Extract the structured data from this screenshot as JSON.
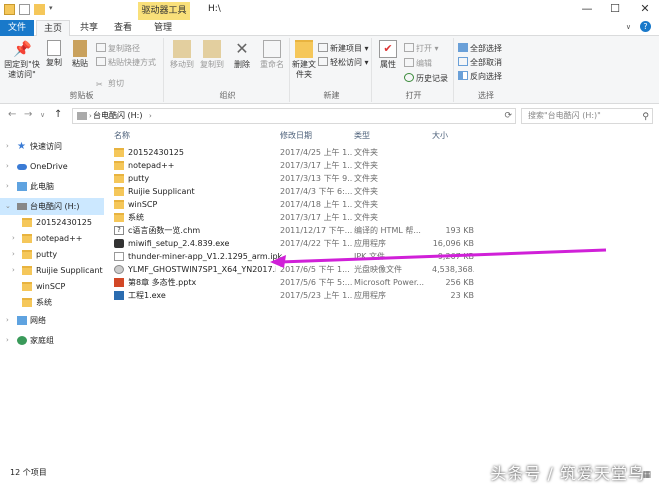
{
  "title": {
    "path": "H:\\",
    "context_tab": "驱动器工具"
  },
  "tabs": [
    "文件",
    "主页",
    "共享",
    "查看",
    "管理"
  ],
  "ribbon": {
    "clipboard": {
      "pin": "固定到\"快速访问\"",
      "copy": "复制",
      "paste": "粘贴",
      "copy_path": "复制路径",
      "paste_shortcut": "粘贴快捷方式",
      "cut": "剪切",
      "label": "剪贴板"
    },
    "organize": {
      "move_to": "移动到",
      "copy_to": "复制到",
      "delete": "删除",
      "rename": "重命名",
      "label": "组织"
    },
    "new": {
      "new_folder": "新建文件夹",
      "new_item": "新建项目",
      "easy_access": "轻松访问",
      "label": "新建"
    },
    "open": {
      "properties": "属性",
      "open": "打开",
      "edit": "编辑",
      "history": "历史记录",
      "label": "打开"
    },
    "select": {
      "select_all": "全部选择",
      "select_none": "全部取消",
      "invert": "反向选择",
      "label": "选择"
    }
  },
  "nav": {
    "address_root": "台电酷闪 (H:)",
    "search_placeholder": "搜索\"台电酷闪 (H:)\""
  },
  "sidebar": {
    "quick_access": "快速访问",
    "onedrive": "OneDrive",
    "this_pc": "此电脑",
    "drive": "台电酷闪 (H:)",
    "children": [
      "20152430125",
      "notepad++",
      "putty",
      "Ruijie Supplicant",
      "winSCP",
      "系统"
    ],
    "network": "网络",
    "homegroup": "家庭组"
  },
  "columns": {
    "name": "名称",
    "date": "修改日期",
    "type": "类型",
    "size": "大小"
  },
  "files": [
    {
      "name": "20152430125",
      "date": "2017/4/25 上午 1...",
      "type": "文件夹",
      "size": "",
      "icon": "folder"
    },
    {
      "name": "notepad++",
      "date": "2017/3/17 上午 1...",
      "type": "文件夹",
      "size": "",
      "icon": "folder"
    },
    {
      "name": "putty",
      "date": "2017/3/13 下午 9...",
      "type": "文件夹",
      "size": "",
      "icon": "folder"
    },
    {
      "name": "Ruijie Supplicant",
      "date": "2017/4/3 下午 6:...",
      "type": "文件夹",
      "size": "",
      "icon": "folder"
    },
    {
      "name": "winSCP",
      "date": "2017/4/18 上午 1...",
      "type": "文件夹",
      "size": "",
      "icon": "folder"
    },
    {
      "name": "系统",
      "date": "2017/3/17 上午 1...",
      "type": "文件夹",
      "size": "",
      "icon": "folder"
    },
    {
      "name": "c语言函数一览.chm",
      "date": "2011/12/17 下午...",
      "type": "编译的 HTML 帮...",
      "size": "193 KB",
      "icon": "chm"
    },
    {
      "name": "miwifi_setup_2.4.839.exe",
      "date": "2017/4/22 下午 1...",
      "type": "应用程序",
      "size": "16,096 KB",
      "icon": "exe"
    },
    {
      "name": "thunder-miner-app_V1.2.1295_arm.ipk",
      "date": "",
      "type": "IPK 文件",
      "size": "9,267 KB",
      "icon": "file"
    },
    {
      "name": "YLMF_GHOSTWIN7SP1_X64_YN2017.i...",
      "date": "2017/6/5 下午 1...",
      "type": "光盘映像文件",
      "size": "4,538,368...",
      "icon": "iso"
    },
    {
      "name": "第8章 多态性.pptx",
      "date": "2017/5/6 下午 5:...",
      "type": "Microsoft Power...",
      "size": "256 KB",
      "icon": "pptx"
    },
    {
      "name": "工程1.exe",
      "date": "2017/5/23 上午 1...",
      "type": "应用程序",
      "size": "23 KB",
      "icon": "app"
    }
  ],
  "status": {
    "count": "12 个项目"
  },
  "watermark": "头条号 / 筑爱天堂鸟"
}
